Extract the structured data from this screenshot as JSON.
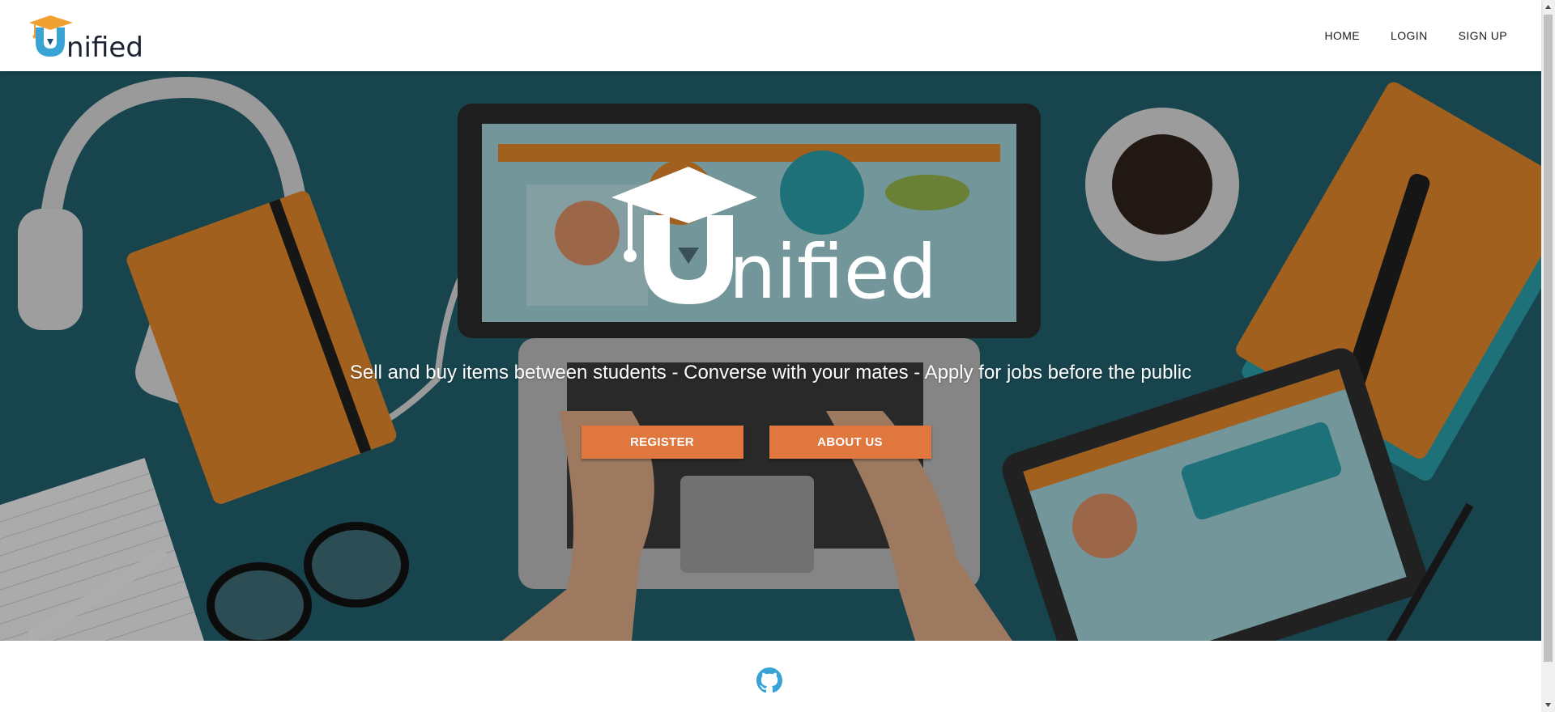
{
  "brand": {
    "logo_text": "nified",
    "logo_letter": "U"
  },
  "nav": {
    "items": [
      {
        "label": "HOME"
      },
      {
        "label": "LOGIN"
      },
      {
        "label": "SIGN UP"
      }
    ]
  },
  "hero": {
    "logo_text": "nified",
    "tagline": "Sell and buy items between students - Converse with your mates - Apply for jobs before the public",
    "buttons": {
      "register": "REGISTER",
      "about": "ABOUT US"
    }
  },
  "footer": {
    "icon": "github-icon"
  },
  "colors": {
    "accent": "#e0773f",
    "hero_bg": "#1f5f6a",
    "github": "#3aa3d6",
    "logo_blue": "#3aa3d6",
    "logo_orange": "#f0a030"
  }
}
